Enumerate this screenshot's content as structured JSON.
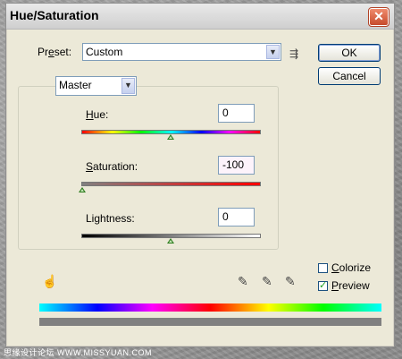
{
  "window": {
    "title": "Hue/Saturation",
    "close_symbol": "✕"
  },
  "preset": {
    "label_prefix": "Pr",
    "label_underlined": "e",
    "label_suffix": "set:",
    "value": "Custom",
    "menu_icon": "⇶"
  },
  "buttons": {
    "ok": "OK",
    "cancel": "Cancel"
  },
  "channel": {
    "value": "Master"
  },
  "adjustments": {
    "hue": {
      "label_underlined": "H",
      "label_rest": "ue:",
      "value": "0",
      "level": 0
    },
    "saturation": {
      "label_prefix": "",
      "label_underlined": "S",
      "label_rest": "aturation:",
      "value": "-100",
      "level": -100
    },
    "lightness": {
      "label_underlined": "",
      "label_rest": "Lightness:",
      "value": "0",
      "level": 0
    }
  },
  "options": {
    "colorize": {
      "label_prefix": "",
      "label_underlined": "C",
      "label_rest": "olorize",
      "checked": false
    },
    "preview": {
      "label_prefix": "",
      "label_underlined": "P",
      "label_rest": "review",
      "checked": true,
      "check_mark": "✓"
    }
  },
  "icons": {
    "hand_adjust": "☝",
    "eyedropper": "✎",
    "eyedropper_plus": "✎",
    "eyedropper_minus": "✎"
  },
  "watermark": "思缘设计论坛  WWW.MISSYUAN.COM"
}
